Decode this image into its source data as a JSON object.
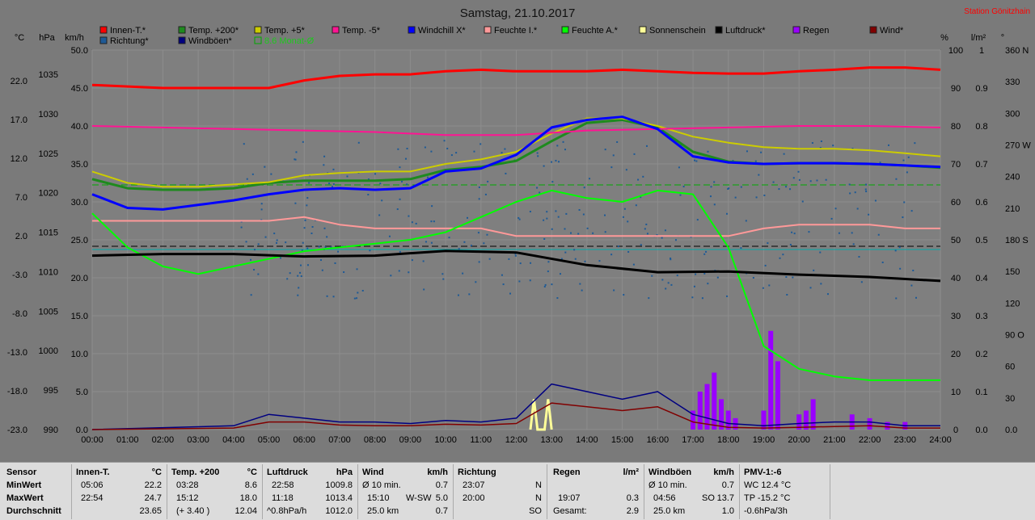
{
  "header": {
    "title": "Samstag, 21.10.2017",
    "station": "Station Gönitzhain"
  },
  "legend": [
    {
      "name": "Innen-T.*",
      "color": "#ff0000"
    },
    {
      "name": "Temp. +200*",
      "color": "#1e8a1e"
    },
    {
      "name": "Temp. +5*",
      "color": "#cccc00"
    },
    {
      "name": "Temp. -5*",
      "color": "#ff1493"
    },
    {
      "name": "Windchill X*",
      "color": "#0000ff"
    },
    {
      "name": "Feuchte I.*",
      "color": "#ff9999"
    },
    {
      "name": "Feuchte A.*",
      "color": "#00ff00"
    },
    {
      "name": "Sonnenschein",
      "color": "#ffff99"
    },
    {
      "name": "Luftdruck*",
      "color": "#000000"
    },
    {
      "name": "Regen",
      "color": "#9900ff"
    },
    {
      "name": "Wind*",
      "color": "#800000"
    },
    {
      "name": "Richtung*",
      "color": "#1e5a96"
    },
    {
      "name": "Windböen*",
      "color": "#000080"
    },
    {
      "name": "8.6 Monat-Ø",
      "color": "#00aa00"
    }
  ],
  "axis_units": {
    "celsius": "°C",
    "hpa": "hPa",
    "kmh": "km/h",
    "percent": "%",
    "lm2": "l/m²",
    "deg": "°"
  },
  "chart_data": {
    "type": "line",
    "title": "Samstag, 21.10.2017",
    "x_ticks": [
      "00:00",
      "01:00",
      "02:00",
      "03:00",
      "04:00",
      "05:00",
      "06:00",
      "07:00",
      "08:00",
      "09:00",
      "10:00",
      "11:00",
      "12:00",
      "13:00",
      "14:00",
      "15:00",
      "16:00",
      "17:00",
      "18:00",
      "19:00",
      "20:00",
      "21:00",
      "22:00",
      "23:00",
      "24:00"
    ],
    "xlim": [
      0,
      24
    ],
    "axes": {
      "temp_c": {
        "ticks": [
          "22.0",
          "17.0",
          "12.0",
          "7.0",
          "2.0",
          "-3.0",
          "-8.0",
          "-13.0",
          "-18.0",
          "-23.0"
        ],
        "ylim": [
          -23,
          27
        ]
      },
      "pressure_hpa": {
        "ticks": [
          "1035",
          "1030",
          "1025",
          "1020",
          "1015",
          "1010",
          "1005",
          "1000",
          "995",
          "990"
        ],
        "ylim": [
          990,
          1038
        ]
      },
      "wind_kmh": {
        "ticks": [
          "50.0",
          "45.0",
          "40.0",
          "35.0",
          "30.0",
          "25.0",
          "20.0",
          "15.0",
          "10.0",
          "5.0",
          "0.0"
        ],
        "ylim": [
          0,
          50
        ]
      },
      "humidity_pct": {
        "ticks": [
          "100",
          "90",
          "80",
          "70",
          "60",
          "50",
          "40",
          "30",
          "20",
          "10",
          "0"
        ],
        "ylim": [
          0,
          100
        ]
      },
      "rain_lm2": {
        "ticks": [
          "1",
          "0.9",
          "0.8",
          "0.7",
          "0.6",
          "0.5",
          "0.4",
          "0.3",
          "0.2",
          "0.1",
          "0.0"
        ],
        "ylim": [
          0,
          1
        ]
      },
      "direction_deg": {
        "ticks": [
          "360 N",
          "330",
          "300",
          "270 W",
          "240",
          "210",
          "180 S",
          "150",
          "120",
          "90 O",
          "60",
          "30",
          "0.0"
        ],
        "ylim": [
          0,
          360
        ]
      }
    },
    "series": [
      {
        "name": "Innen-T.*",
        "axis": "temp_c",
        "x": [
          0,
          1,
          2,
          3,
          4,
          5,
          6,
          7,
          8,
          9,
          10,
          11,
          12,
          13,
          14,
          15,
          16,
          17,
          18,
          19,
          20,
          21,
          22,
          23,
          24
        ],
        "y": [
          22.4,
          22.2,
          22.0,
          22.0,
          22.0,
          22.0,
          23.0,
          23.6,
          23.8,
          23.8,
          24.2,
          24.4,
          24.2,
          24.2,
          24.2,
          24.4,
          24.2,
          24.0,
          23.9,
          23.9,
          24.2,
          24.4,
          24.7,
          24.7,
          24.4
        ]
      },
      {
        "name": "Temp. +200*",
        "axis": "temp_c",
        "x": [
          0,
          1,
          2,
          3,
          4,
          5,
          6,
          7,
          8,
          9,
          10,
          11,
          12,
          13,
          14,
          15,
          16,
          17,
          18,
          19,
          20,
          21,
          22,
          23,
          24
        ],
        "y": [
          10.0,
          8.8,
          8.6,
          8.6,
          8.8,
          9.5,
          9.8,
          9.8,
          9.8,
          10.0,
          11.2,
          11.6,
          12.4,
          15.0,
          17.4,
          17.8,
          16.8,
          13.6,
          12.3,
          12.0,
          12.1,
          12.1,
          12.0,
          11.8,
          11.5
        ]
      },
      {
        "name": "Temp. +5*",
        "axis": "temp_c",
        "x": [
          0,
          1,
          2,
          3,
          4,
          5,
          6,
          7,
          8,
          9,
          10,
          11,
          12,
          13,
          14,
          15,
          16,
          17,
          18,
          19,
          20,
          21,
          22,
          23,
          24
        ],
        "y": [
          11.0,
          9.5,
          9.0,
          9.0,
          9.3,
          9.6,
          10.5,
          10.8,
          11.0,
          11.0,
          12.0,
          12.6,
          13.6,
          16.0,
          18.0,
          18.0,
          17.0,
          15.6,
          14.8,
          14.2,
          14.0,
          14.0,
          13.8,
          13.4,
          13.0
        ]
      },
      {
        "name": "Temp. -5*",
        "axis": "temp_c",
        "x": [
          0,
          2,
          4,
          6,
          8,
          10,
          12,
          14,
          16,
          18,
          20,
          22,
          24
        ],
        "y": [
          17.0,
          16.8,
          16.6,
          16.4,
          16.2,
          15.8,
          15.8,
          16.4,
          16.6,
          16.8,
          17.0,
          17.0,
          16.8
        ]
      },
      {
        "name": "Windchill X*",
        "axis": "temp_c",
        "x": [
          0,
          1,
          2,
          3,
          4,
          5,
          6,
          7,
          8,
          9,
          10,
          11,
          12,
          13,
          14,
          15,
          16,
          17,
          18,
          19,
          20,
          21,
          22,
          23,
          24
        ],
        "y": [
          8.0,
          6.2,
          6.0,
          6.6,
          7.2,
          8.0,
          8.6,
          8.8,
          8.6,
          8.8,
          11.0,
          11.4,
          13.2,
          16.8,
          17.8,
          18.2,
          16.6,
          13.0,
          12.2,
          12.0,
          12.1,
          12.1,
          12.0,
          11.8,
          11.6
        ]
      },
      {
        "name": "Feuchte I.*",
        "axis": "humidity_pct",
        "x": [
          0,
          2,
          4,
          5,
          6,
          7,
          8,
          9,
          10,
          11,
          12,
          14,
          16,
          18,
          19,
          20,
          21,
          22,
          23,
          24
        ],
        "y": [
          55,
          55,
          55,
          55,
          56,
          54,
          53,
          53,
          53,
          53,
          51,
          51,
          51,
          51,
          53,
          54,
          54,
          54,
          53,
          53
        ]
      },
      {
        "name": "Feuchte A.*",
        "axis": "humidity_pct",
        "x": [
          0,
          1,
          2,
          3,
          4,
          5,
          6,
          7,
          8,
          9,
          10,
          11,
          12,
          13,
          14,
          15,
          16,
          17,
          18,
          18.5,
          19,
          20,
          21,
          22,
          23,
          24
        ],
        "y": [
          57,
          48,
          43,
          41,
          43,
          45,
          47,
          48,
          49,
          50,
          52,
          56,
          60,
          63,
          61,
          60,
          63,
          62,
          48,
          35,
          22,
          16,
          14,
          13,
          13,
          13
        ]
      },
      {
        "name": "Luftdruck*",
        "axis": "pressure_hpa",
        "x": [
          0,
          2,
          4,
          6,
          8,
          10,
          12,
          14,
          16,
          18,
          20,
          22,
          24
        ],
        "y": [
          1012.0,
          1012.2,
          1012.2,
          1011.9,
          1012.0,
          1012.6,
          1012.4,
          1010.8,
          1009.9,
          1010.0,
          1009.6,
          1009.3,
          1008.8
        ]
      },
      {
        "name": "Windböen*",
        "axis": "wind_kmh",
        "x": [
          0,
          4,
          5,
          6,
          7,
          8,
          9,
          10,
          11,
          12,
          13,
          14,
          15,
          16,
          17,
          18,
          19,
          20,
          21,
          22,
          23,
          24
        ],
        "y": [
          0,
          0.5,
          2,
          1.5,
          1,
          1,
          0.8,
          1.2,
          1,
          1.5,
          6,
          5,
          4,
          5,
          2,
          0.8,
          0.5,
          0.8,
          1,
          1,
          0.5,
          0.5
        ]
      },
      {
        "name": "Wind*",
        "axis": "wind_kmh",
        "x": [
          0,
          4,
          5,
          6,
          7,
          8,
          9,
          10,
          11,
          12,
          13,
          14,
          15,
          16,
          17,
          18,
          19,
          20,
          21,
          22,
          23,
          24
        ],
        "y": [
          0,
          0.2,
          1,
          1,
          0.6,
          0.5,
          0.5,
          0.7,
          0.6,
          0.8,
          3.5,
          3,
          2.5,
          3,
          1,
          0.3,
          0.2,
          0.3,
          0.4,
          0.5,
          0.2,
          0.2
        ]
      },
      {
        "name": "8.6 Monat-Ø",
        "axis": "temp_c",
        "x": [
          0,
          24
        ],
        "y": [
          8.6,
          8.6
        ]
      }
    ],
    "rain_bars": {
      "axis": "rain_lm2",
      "x": [
        17.0,
        17.2,
        17.4,
        17.6,
        17.8,
        18.0,
        18.2,
        19.0,
        19.2,
        19.4,
        20.0,
        20.2,
        20.4,
        21.5,
        22.0,
        22.5,
        23.0
      ],
      "y": [
        0.05,
        0.1,
        0.12,
        0.15,
        0.08,
        0.05,
        0.03,
        0.05,
        0.26,
        0.18,
        0.04,
        0.05,
        0.08,
        0.04,
        0.03,
        0.02,
        0.02
      ]
    },
    "sunshine": {
      "axis": "wind_kmh",
      "x": [
        12.4,
        12.5,
        12.6,
        12.8,
        12.9,
        13.0
      ],
      "y": [
        0,
        4,
        0,
        0,
        4,
        0
      ]
    },
    "direction_points": {
      "axis": "direction_deg",
      "note": "scattered wind direction points"
    }
  },
  "stats": {
    "sensor": {
      "header": "Sensor",
      "rows": [
        "MinWert",
        "MaxWert",
        "Durchschnitt"
      ]
    },
    "innen": {
      "header": "Innen-T.",
      "unit": "°C",
      "rows": [
        [
          "05:06",
          "22.2"
        ],
        [
          "22:54",
          "24.7"
        ],
        [
          "",
          "23.65"
        ]
      ]
    },
    "temp200": {
      "header": "Temp. +200",
      "unit": "°C",
      "rows": [
        [
          "03:28",
          "8.6"
        ],
        [
          "15:12",
          "18.0"
        ],
        [
          "(+ 3.40 )",
          "12.04"
        ]
      ]
    },
    "luftdruck": {
      "header": "Luftdruck",
      "unit": "hPa",
      "rows": [
        [
          "22:58",
          "1009.8"
        ],
        [
          "11:18",
          "1013.4"
        ],
        [
          "^0.8hPa/h",
          "1012.0"
        ]
      ]
    },
    "wind": {
      "header": "Wind",
      "unit": "km/h",
      "rows": [
        [
          "Ø 10 min.",
          "",
          "0.7"
        ],
        [
          "15:10",
          "W-SW",
          "5.0"
        ],
        [
          "25.0 km",
          "",
          "0.7"
        ]
      ]
    },
    "richtung": {
      "header": "Richtung",
      "rows": [
        [
          "23:07",
          "N"
        ],
        [
          "20:00",
          "N"
        ],
        [
          "",
          "SO"
        ]
      ]
    },
    "regen": {
      "header": "Regen",
      "unit": "l/m²",
      "rows": [
        [
          "",
          ""
        ],
        [
          "19:07",
          "0.3"
        ],
        [
          "Gesamt:",
          "2.9"
        ]
      ]
    },
    "boeen": {
      "header": "Windböen",
      "unit": "km/h",
      "rows": [
        [
          "Ø 10 min.",
          "",
          "0.7"
        ],
        [
          "04:56",
          "SO",
          "13.7"
        ],
        [
          "25.0 km",
          "",
          "1.0"
        ]
      ]
    },
    "pmv": {
      "header": "PMV-1:-6",
      "rows": [
        "WC 12.4 °C",
        "TP -15.2 °C",
        "-0.6hPa/3h"
      ]
    }
  }
}
